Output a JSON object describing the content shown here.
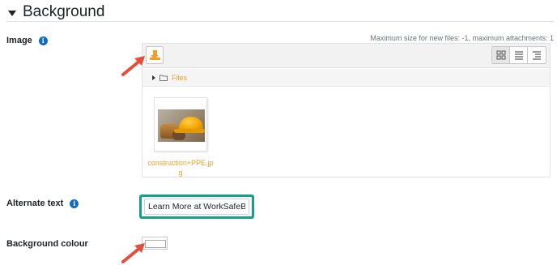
{
  "section": {
    "title": "Background"
  },
  "image_field": {
    "label": "Image",
    "max_size_note": "Maximum size for new files: -1, maximum attachments: 1",
    "path_label": "Files",
    "file": {
      "name": "construction+PPE.jpg"
    }
  },
  "alt_text_field": {
    "label": "Alternate text",
    "value": "Learn More at WorkSafeBC"
  },
  "background_colour_field": {
    "label": "Background colour"
  },
  "icons": {
    "section_toggle": "caret-down-icon",
    "info": "info-icon",
    "add_file": "download-icon",
    "view_icons": "grid-view-icon",
    "view_list": "list-view-icon",
    "view_tree": "tree-view-icon",
    "folder": "folder-icon",
    "callout": "arrow-pointer-icon"
  },
  "colors": {
    "accent_orange": "#f0a026",
    "info_blue": "#0f6cbf",
    "highlight_teal": "#16a085",
    "callout_red": "#e74c3c"
  }
}
